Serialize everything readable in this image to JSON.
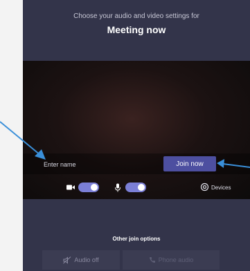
{
  "header": {
    "subtitle": "Choose your audio and video settings for",
    "title": "Meeting now"
  },
  "join_bar": {
    "name_placeholder": "Enter name",
    "join_label": "Join now"
  },
  "controls": {
    "camera_on": true,
    "mic_on": true,
    "devices_label": "Devices"
  },
  "other_options": {
    "title": "Other join options",
    "audio_off_label": "Audio off",
    "phone_audio_label": "Phone audio"
  },
  "colors": {
    "panel": "#33344a",
    "accent": "#4d4fa0",
    "toggle": "#7b7fd6",
    "arrow": "#3a8fd9"
  }
}
